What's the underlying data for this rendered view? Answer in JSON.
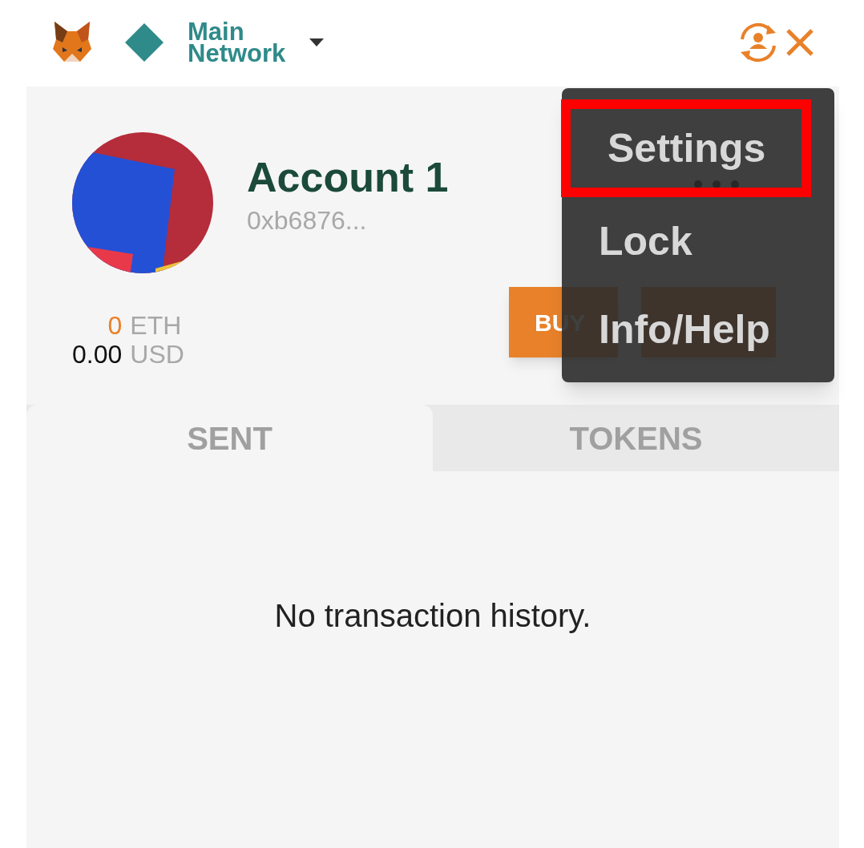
{
  "header": {
    "network": {
      "line_1": "Main",
      "line_2": "Network"
    }
  },
  "account": {
    "name": "Account 1",
    "address": "0xb6876...",
    "balance": {
      "amount": "0",
      "unit": "ETH"
    },
    "fiat": {
      "amount": "0.00",
      "unit": "USD"
    }
  },
  "buttons": [
    {
      "kind": "buy",
      "label": "BUY"
    },
    {
      "kind": "send"
    }
  ],
  "menu": {
    "items": [
      {
        "label": "Settings",
        "highlighted": true
      },
      {
        "label": "Lock",
        "highlighted": false
      },
      {
        "label": "Info/Help",
        "highlighted": false
      }
    ]
  },
  "tabs": [
    {
      "label": "SENT",
      "selected": true
    },
    {
      "label": "TOKENS",
      "selected": false
    }
  ],
  "empty_message": "No transaction history."
}
